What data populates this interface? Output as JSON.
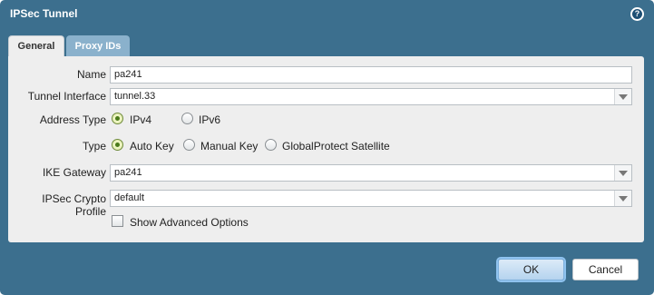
{
  "dialog": {
    "title": "IPSec Tunnel",
    "help_icon": "help-icon",
    "help_glyph": "?"
  },
  "tabs": [
    {
      "label": "General",
      "active": true
    },
    {
      "label": "Proxy IDs",
      "active": false
    }
  ],
  "form": {
    "name": {
      "label": "Name",
      "value": "pa241"
    },
    "tunnel_interface": {
      "label": "Tunnel Interface",
      "value": "tunnel.33"
    },
    "address_type": {
      "label": "Address Type",
      "options": [
        {
          "label": "IPv4",
          "checked": true
        },
        {
          "label": "IPv6",
          "checked": false
        }
      ]
    },
    "type": {
      "label": "Type",
      "options": [
        {
          "label": "Auto Key",
          "checked": true
        },
        {
          "label": "Manual Key",
          "checked": false
        },
        {
          "label": "GlobalProtect Satellite",
          "checked": false
        }
      ]
    },
    "ike_gateway": {
      "label": "IKE Gateway",
      "value": "pa241"
    },
    "ipsec_crypto_profile": {
      "label": "IPSec Crypto Profile",
      "value": "default"
    },
    "show_advanced": {
      "label": "Show Advanced Options",
      "checked": false
    }
  },
  "buttons": {
    "ok": "OK",
    "cancel": "Cancel"
  }
}
